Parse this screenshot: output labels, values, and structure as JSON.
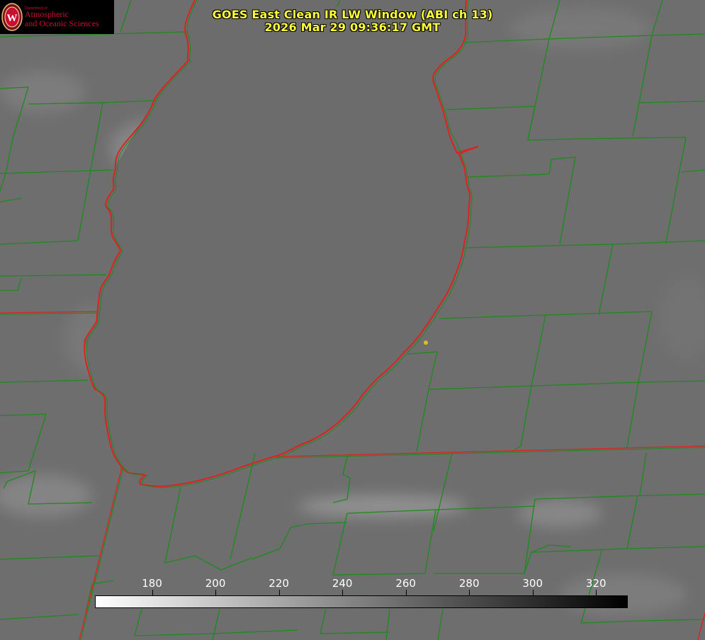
{
  "title": "GOES East Clean IR LW Window (ABI ch 13)",
  "timestamp": "2026 Mar 29 09:36:17 GMT",
  "logo": {
    "department": "Department of",
    "line1": "Atmospheric",
    "line2": "and Oceanic Sciences",
    "seal_letter": "W"
  },
  "colorbar": {
    "min": 162,
    "max": 330,
    "gradient_start": "#ffffff",
    "gradient_end": "#000000",
    "ticks": [
      "180",
      "200",
      "220",
      "240",
      "260",
      "280",
      "300",
      "320"
    ]
  },
  "colors": {
    "title_text": "#ffff3a",
    "county_lines": "#1d8a1d",
    "state_and_coast_lines": "#e02020",
    "station_marker": "#d8c020",
    "tick_labels": "#ffffff"
  }
}
